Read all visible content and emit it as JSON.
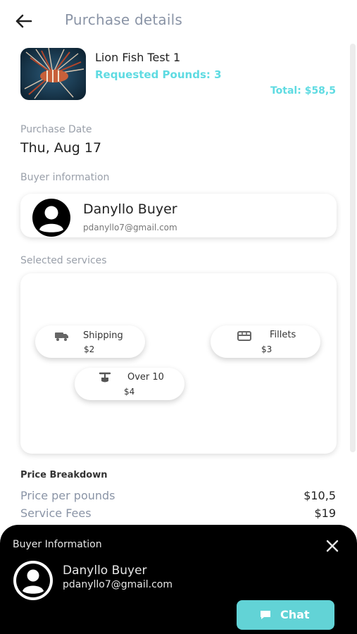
{
  "header": {
    "title": "Purchase details"
  },
  "product": {
    "name": "Lion Fish Test 1",
    "requested": "Requested Pounds: 3",
    "total": "Total: $58,5"
  },
  "purchase_date": {
    "label": "Purchase Date",
    "value": "Thu, Aug 17"
  },
  "buyer": {
    "section_label": "Buyer information",
    "name": "Danyllo Buyer",
    "email": "pdanyllo7@gmail.com"
  },
  "services": {
    "section_label": "Selected services",
    "items": [
      {
        "name": "Shipping",
        "price": "$2",
        "icon": "truck-icon"
      },
      {
        "name": "Fillets",
        "price": "$3",
        "icon": "storefront-icon"
      },
      {
        "name": "Over 10",
        "price": "$4",
        "icon": "scale-icon"
      }
    ]
  },
  "breakdown": {
    "title": "Price Breakdown",
    "rows": [
      {
        "label": "Price per pounds",
        "value": "$10,5"
      },
      {
        "label": "Service Fees",
        "value": "$19"
      }
    ]
  },
  "sheet": {
    "title": "Buyer Information",
    "name": "Danyllo Buyer",
    "email": "pdanyllo7@gmail.com",
    "chat_label": "Chat"
  },
  "colors": {
    "accent": "#5fdbe2",
    "chat_button": "#62d3d6",
    "sheet_bg": "#000000"
  }
}
